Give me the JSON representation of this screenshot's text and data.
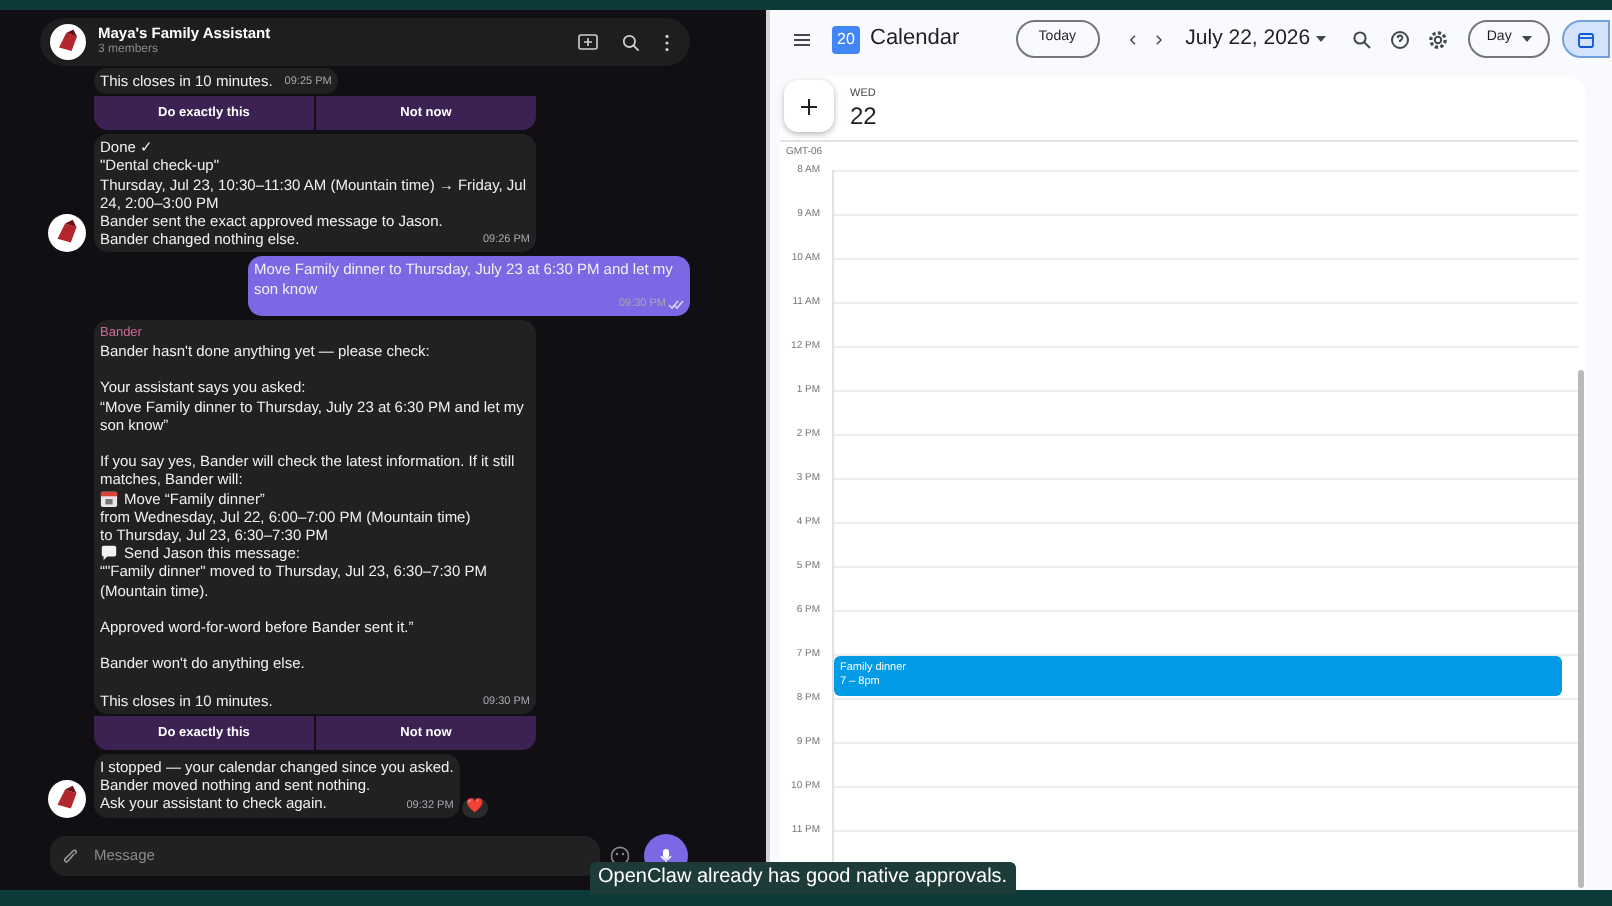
{
  "chat": {
    "title": "Maya's Family Assistant",
    "subtitle": "3 members",
    "messages": [
      {
        "kind": "bot",
        "avatar": false,
        "paragraphs": [
          [
            "This closes in 10 minutes."
          ]
        ],
        "time": "09:25 PM",
        "buttons": [
          "Do exactly this",
          "Not now"
        ]
      },
      {
        "kind": "bot",
        "avatar": true,
        "paragraphs": [
          [
            "Done ✓",
            "\"Dental check-up\"",
            "Thursday, Jul 23, 10:30–11:30 AM (Mountain time) → Friday, Jul 24, 2:00–3:00 PM",
            "Bander sent the exact approved message to Jason.",
            "Bander changed nothing else."
          ]
        ],
        "time": "09:26 PM"
      },
      {
        "kind": "user",
        "read": true,
        "paragraphs": [
          [
            "Move Family dinner to Thursday, July 23 at 6:30 PM and let my son know"
          ]
        ],
        "time": "09:30 PM"
      },
      {
        "kind": "bot",
        "avatar": false,
        "sender": "Bander",
        "paragraphs": [
          [
            "Bander hasn't done anything yet — please check:"
          ],
          [
            "Your assistant says you asked:",
            "“Move Family dinner to Thursday, July 23 at 6:30 PM and let my son know”"
          ],
          [
            "If you say yes, Bander will check the latest information. If it still matches, Bander will:",
            {
              "kind": "event",
              "text": "Move “Family dinner”"
            },
            "from Wednesday, Jul 22, 6:00–7:00 PM (Mountain time)",
            "to Thursday, Jul 23, 6:30–7:30 PM",
            {
              "kind": "message",
              "text": "Send Jason this message:"
            },
            "“\"Family dinner\" moved to Thursday, Jul 23, 6:30–7:30 PM (Mountain time)."
          ],
          [
            "Approved word-for-word before Bander sent it.”"
          ],
          [
            "Bander won't do anything else."
          ],
          [
            "This closes in 10 minutes."
          ]
        ],
        "time": "09:30 PM",
        "buttons": [
          "Do exactly this",
          "Not now"
        ]
      },
      {
        "kind": "bot",
        "avatar": true,
        "paragraphs": [
          [
            "I stopped — your calendar changed since you asked.",
            "Bander moved nothing and sent nothing.",
            "Ask your assistant to check again."
          ]
        ],
        "time": "09:32 PM",
        "reaction": "❤️"
      }
    ],
    "input": {
      "placeholder": "Message"
    }
  },
  "calendar": {
    "date_badge": "20",
    "app_name": "Calendar",
    "today_button": "Today",
    "current_date": "July 22, 2026",
    "view": "Day",
    "day_name": "WED",
    "day_number": "22",
    "timezone": "GMT-06",
    "hours": [
      {
        "label": "8 AM"
      },
      {
        "label": "9 AM"
      },
      {
        "label": "10 AM"
      },
      {
        "label": "11 AM"
      },
      {
        "label": "12 PM"
      },
      {
        "label": "1 PM"
      },
      {
        "label": "2 PM"
      },
      {
        "label": "3 PM"
      },
      {
        "label": "4 PM"
      },
      {
        "label": "5 PM"
      },
      {
        "label": "6 PM"
      },
      {
        "label": "7 PM",
        "events": [
          {
            "title": "Family dinner",
            "time": "7 – 8pm"
          }
        ]
      },
      {
        "label": "8 PM"
      },
      {
        "label": "9 PM"
      },
      {
        "label": "10 PM"
      },
      {
        "label": "11 PM"
      }
    ]
  },
  "caption": "OpenClaw already has good native approvals."
}
